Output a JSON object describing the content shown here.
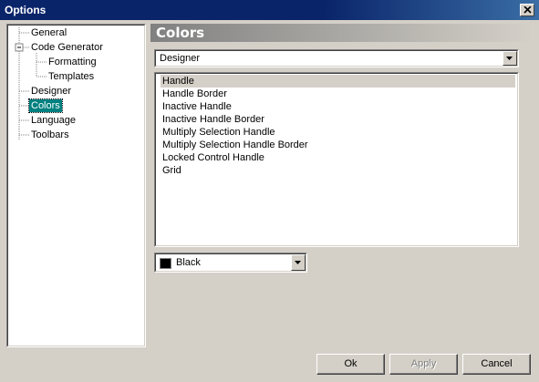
{
  "window": {
    "title": "Options",
    "close_icon": "close-icon"
  },
  "tree": {
    "items": [
      {
        "label": "General",
        "level": 0
      },
      {
        "label": "Code Generator",
        "level": 0,
        "expanded": true
      },
      {
        "label": "Formatting",
        "level": 1
      },
      {
        "label": "Templates",
        "level": 1
      },
      {
        "label": "Designer",
        "level": 0
      },
      {
        "label": "Colors",
        "level": 0,
        "selected": true
      },
      {
        "label": "Language",
        "level": 0
      },
      {
        "label": "Toolbars",
        "level": 0
      }
    ]
  },
  "panel": {
    "title": "Colors",
    "category_select": {
      "value": "Designer"
    },
    "color_items": [
      "Handle",
      "Handle Border",
      "Inactive Handle",
      "Inactive Handle Border",
      "Multiply Selection Handle",
      "Multiply Selection Handle Border",
      "Locked Control Handle",
      "Grid"
    ],
    "selected_color_item": "Handle",
    "color_select": {
      "value": "Black",
      "swatch": "#000000"
    }
  },
  "buttons": {
    "ok": "Ok",
    "apply": "Apply",
    "cancel": "Cancel"
  },
  "colors": {
    "titlebar": "#0a246a",
    "selection": "#008080",
    "face": "#d4d0c8"
  }
}
